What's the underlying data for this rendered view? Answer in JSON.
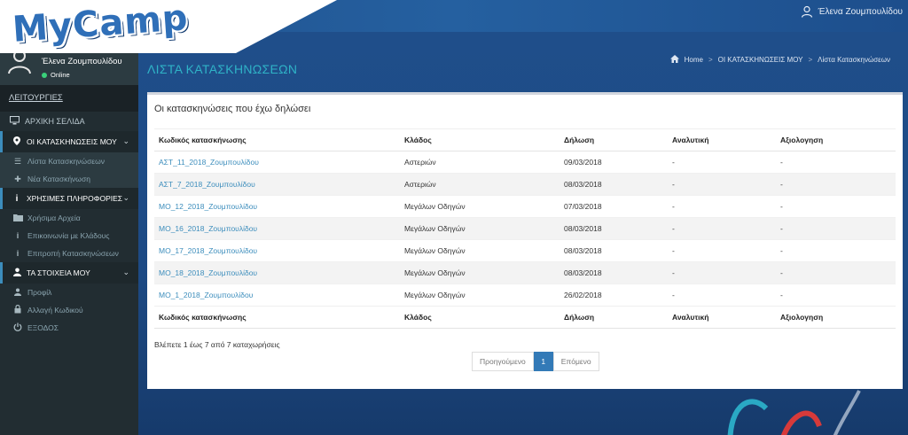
{
  "app": {
    "logo": "MyCamp"
  },
  "topbar": {
    "user_name": "Έλενα Ζουμπουλίδου"
  },
  "sidebar": {
    "profile": {
      "name": "Έλενα Ζουμπουλίδου",
      "status": "Online",
      "status_color": "#3ad07a"
    },
    "header": "ΛΕΙΤΟΥΡΓΙΕΣ",
    "home": {
      "label": "ΑΡΧΙΚΗ ΣΕΛΙΔΑ",
      "icon": "monitor-icon"
    },
    "sections": [
      {
        "label": "ΟΙ ΚΑΤΑΣΚΗΝΩΣΕΙΣ ΜΟΥ",
        "icon": "map-marker-icon",
        "items": [
          {
            "label": "Λίστα Κατασκηνώσεων",
            "icon": "list-icon"
          },
          {
            "label": "Νέα Κατασκήνωση",
            "icon": "plus-icon"
          }
        ]
      },
      {
        "label": "ΧΡΗΣΙΜΕΣ ΠΛΗΡΟΦΟΡΙΕΣ",
        "icon": "info-icon",
        "items": [
          {
            "label": "Χρήσιμα Αρχεία",
            "icon": "folder-icon"
          },
          {
            "label": "Επικοινωνία με Κλάδους",
            "icon": "info-icon"
          },
          {
            "label": "Επιτροπή Κατασκηνώσεων",
            "icon": "info-icon"
          }
        ]
      },
      {
        "label": "ΤΑ ΣΤΟΙΧΕΙΑ ΜΟΥ",
        "icon": "user-icon",
        "items": [
          {
            "label": "Προφίλ",
            "icon": "user-icon"
          },
          {
            "label": "Αλλαγή Κωδικού",
            "icon": "lock-icon"
          },
          {
            "label": "ΕΞΟΔΟΣ",
            "icon": "power-icon"
          }
        ]
      }
    ]
  },
  "main": {
    "page_title": "ΛΙΣΤΑ ΚΑΤΑΣΚΗΝΩΣΕΩΝ",
    "breadcrumb": [
      "Home",
      "ΟΙ ΚΑΤΑΣΚΗΝΩΣΕΙΣ ΜΟΥ",
      "Λίστα Κατασκηνώσεων"
    ],
    "panel_title": "Οι κατασκηνώσεις που έχω δηλώσει",
    "table": {
      "headers": [
        "Κωδικός κατασκήνωσης",
        "Κλάδος",
        "Δήλωση",
        "Αναλυτική",
        "Αξιολογηση"
      ],
      "rows": [
        [
          "ΑΣΤ_11_2018_Ζουμπουλίδου",
          "Αστεριών",
          "09/03/2018",
          "-",
          "-"
        ],
        [
          "ΑΣΤ_7_2018_Ζουμπουλίδου",
          "Αστεριών",
          "08/03/2018",
          "-",
          "-"
        ],
        [
          "ΜΟ_12_2018_Ζουμπουλίδου",
          "Μεγάλων Οδηγών",
          "07/03/2018",
          "-",
          "-"
        ],
        [
          "ΜΟ_16_2018_Ζουμπουλίδου",
          "Μεγάλων Οδηγών",
          "08/03/2018",
          "-",
          "-"
        ],
        [
          "ΜΟ_17_2018_Ζουμπουλίδου",
          "Μεγάλων Οδηγών",
          "08/03/2018",
          "-",
          "-"
        ],
        [
          "ΜΟ_18_2018_Ζουμπουλίδου",
          "Μεγάλων Οδηγών",
          "08/03/2018",
          "-",
          "-"
        ],
        [
          "ΜΟ_1_2018_Ζουμπουλίδου",
          "Μεγάλων Οδηγών",
          "26/02/2018",
          "-",
          "-"
        ]
      ]
    },
    "info_text": "Βλέπετε 1 έως 7 από 7 καταχωρήσεις",
    "pagination": {
      "prev": "Προηγούμενο",
      "current": "1",
      "next": "Επόμενο"
    }
  },
  "colors": {
    "accent": "#3c8dbc",
    "title": "#2fb3c7",
    "sidebar": "#222d32"
  }
}
